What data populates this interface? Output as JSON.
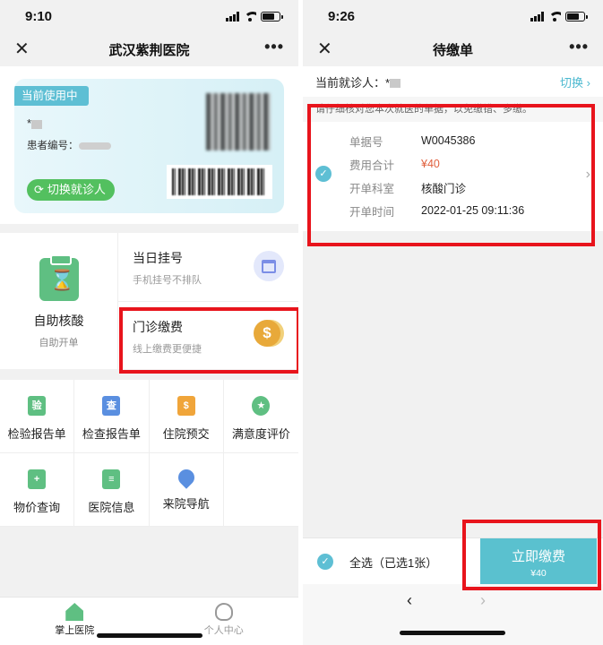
{
  "left": {
    "status": {
      "time": "9:10"
    },
    "nav": {
      "close": "✕",
      "title": "武汉紫荆医院",
      "more": "•••"
    },
    "card": {
      "badge": "当前使用中",
      "name_prefix": "*",
      "patient_id_label": "患者编号：",
      "switch_button": "切换就诊人",
      "switch_icon": "refresh-icon"
    },
    "services": {
      "nucleic": {
        "title": "自助核酸",
        "subtitle": "自助开单"
      },
      "register": {
        "title": "当日挂号",
        "subtitle": "手机挂号不排队"
      },
      "outpatient_pay": {
        "title": "门诊缴费",
        "subtitle": "线上缴费更便捷"
      }
    },
    "grid_items": [
      {
        "label": "检验报告单",
        "icon_glyph": "验",
        "icon": "lab-report-icon",
        "color": "#5fbf82"
      },
      {
        "label": "检查报告单",
        "icon_glyph": "查",
        "icon": "exam-report-icon",
        "color": "#5a8fe0"
      },
      {
        "label": "住院预交",
        "icon_glyph": "$",
        "icon": "hospital-deposit-icon",
        "color": "#f0a53a"
      },
      {
        "label": "满意度评价",
        "icon_glyph": "★",
        "icon": "star-icon",
        "color": "#5fbf82"
      },
      {
        "label": "物价查询",
        "icon_glyph": "+",
        "icon": "price-query-icon",
        "color": "#5fbf82"
      },
      {
        "label": "医院信息",
        "icon_glyph": "≡",
        "icon": "hospital-info-icon",
        "color": "#5fbf82"
      },
      {
        "label": "来院导航",
        "icon_glyph": "",
        "icon": "location-pin-icon",
        "color": "#5a8fe0"
      }
    ],
    "tabs": [
      {
        "label": "掌上医院",
        "icon": "home-icon"
      },
      {
        "label": "个人中心",
        "icon": "user-icon"
      }
    ]
  },
  "right": {
    "status": {
      "time": "9:26"
    },
    "nav": {
      "close": "✕",
      "title": "待缴单",
      "more": "•••"
    },
    "patient_bar": {
      "label": "当前就诊人：*",
      "switch": "切换 ›"
    },
    "notice": "请仔细核对您本次就医的单据，以免缴错、多缴。",
    "bill": {
      "check": "✓",
      "fields": [
        {
          "key": "单据号",
          "value": "W0045386"
        },
        {
          "key": "费用合计",
          "value": "¥40"
        },
        {
          "key": "开单科室",
          "value": "核酸门诊"
        },
        {
          "key": "开单时间",
          "value": "2022-01-25 09:11:36"
        }
      ],
      "chevron": "›"
    },
    "bottom": {
      "check": "✓",
      "select_all": "全选（已选1张）",
      "pay_label": "立即缴费",
      "pay_amount": "¥40"
    },
    "browser": {
      "back": "‹",
      "forward": "›"
    }
  },
  "colors": {
    "accent_teal": "#5ebfd4",
    "accent_green": "#53c05f",
    "price_red": "#e0603e",
    "highlight_red": "#e8141c"
  }
}
